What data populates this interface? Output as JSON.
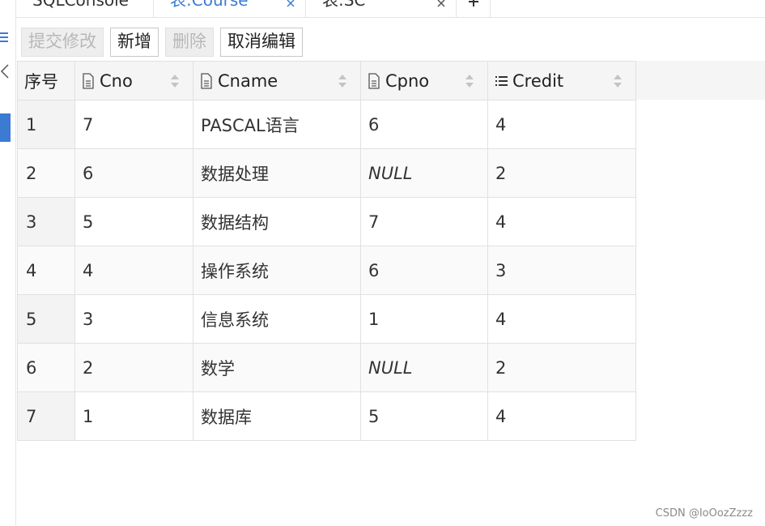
{
  "tabs": [
    {
      "label": "SQLConsole",
      "active": false
    },
    {
      "label": "表:Course",
      "active": true
    },
    {
      "label": "表:SC",
      "active": false
    }
  ],
  "toolbar": {
    "submit_label": "提交修改",
    "add_label": "新增",
    "delete_label": "删除",
    "cancel_label": "取消编辑"
  },
  "grid": {
    "columns": [
      {
        "label": "序号"
      },
      {
        "label": "Cno",
        "icon": "text-column-icon"
      },
      {
        "label": "Cname",
        "icon": "text-column-icon"
      },
      {
        "label": "Cpno",
        "icon": "text-column-icon"
      },
      {
        "label": "Credit",
        "icon": "number-column-icon"
      }
    ],
    "rows": [
      [
        "1",
        "7",
        "PASCAL语言",
        "6",
        "4"
      ],
      [
        "2",
        "6",
        "数据处理",
        "NULL",
        "2"
      ],
      [
        "3",
        "5",
        "数据结构",
        "7",
        "4"
      ],
      [
        "4",
        "4",
        "操作系统",
        "6",
        "3"
      ],
      [
        "5",
        "3",
        "信息系统",
        "1",
        "4"
      ],
      [
        "6",
        "2",
        "数学",
        "NULL",
        "2"
      ],
      [
        "7",
        "1",
        "数据库",
        "5",
        "4"
      ]
    ]
  },
  "watermark": "CSDN @IoOozZzzz",
  "colors": {
    "accent": "#3b7bd4",
    "null_text": "#a6a6a6"
  }
}
